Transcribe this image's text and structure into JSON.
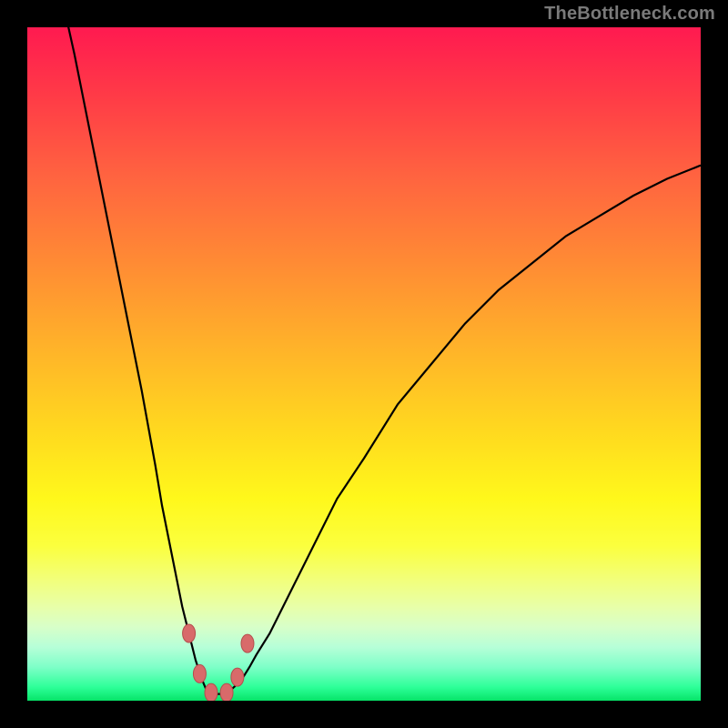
{
  "watermark": {
    "text": "TheBottleneck.com"
  },
  "colors": {
    "frame": "#000000",
    "curve": "#000000",
    "marker_fill": "#d86a6a",
    "marker_stroke": "#b54d4d",
    "gradient_top": "#ff1a50",
    "gradient_bottom": "#06e468"
  },
  "chart_data": {
    "type": "line",
    "title": "",
    "xlabel": "",
    "ylabel": "",
    "xlim": [
      0,
      100
    ],
    "ylim": [
      0,
      100
    ],
    "grid": false,
    "curve_left": {
      "description": "Steep descending branch from top-left down to valley",
      "x": [
        5,
        7,
        9,
        11,
        13,
        15,
        17,
        19,
        20,
        21,
        22,
        23,
        23.5,
        24,
        24.5,
        25,
        25.5,
        26,
        26.5,
        27
      ],
      "y_pct": [
        105,
        96,
        86,
        76,
        66,
        56,
        46,
        35,
        29,
        24,
        19,
        14,
        12,
        10,
        8,
        6,
        4.5,
        3,
        1.8,
        1.2
      ]
    },
    "curve_right": {
      "description": "Rising branch from valley toward upper right, concave",
      "x": [
        30,
        31,
        32,
        33,
        34,
        36,
        38,
        40,
        43,
        46,
        50,
        55,
        60,
        65,
        70,
        75,
        80,
        85,
        90,
        95,
        100
      ],
      "y_pct": [
        1.4,
        2.3,
        3.4,
        5,
        6.8,
        10,
        14,
        18,
        24,
        30,
        36,
        44,
        50,
        56,
        61,
        65,
        69,
        72,
        75,
        77.5,
        79.5
      ]
    },
    "valley_floor": {
      "x": [
        27,
        28,
        29,
        30
      ],
      "y_pct": [
        1.2,
        1.0,
        1.0,
        1.4
      ]
    },
    "markers": [
      {
        "x": 24.0,
        "y_pct": 10.0
      },
      {
        "x": 25.6,
        "y_pct": 4.0
      },
      {
        "x": 27.3,
        "y_pct": 1.2
      },
      {
        "x": 29.6,
        "y_pct": 1.2
      },
      {
        "x": 31.2,
        "y_pct": 3.5
      },
      {
        "x": 32.7,
        "y_pct": 8.5
      }
    ]
  }
}
